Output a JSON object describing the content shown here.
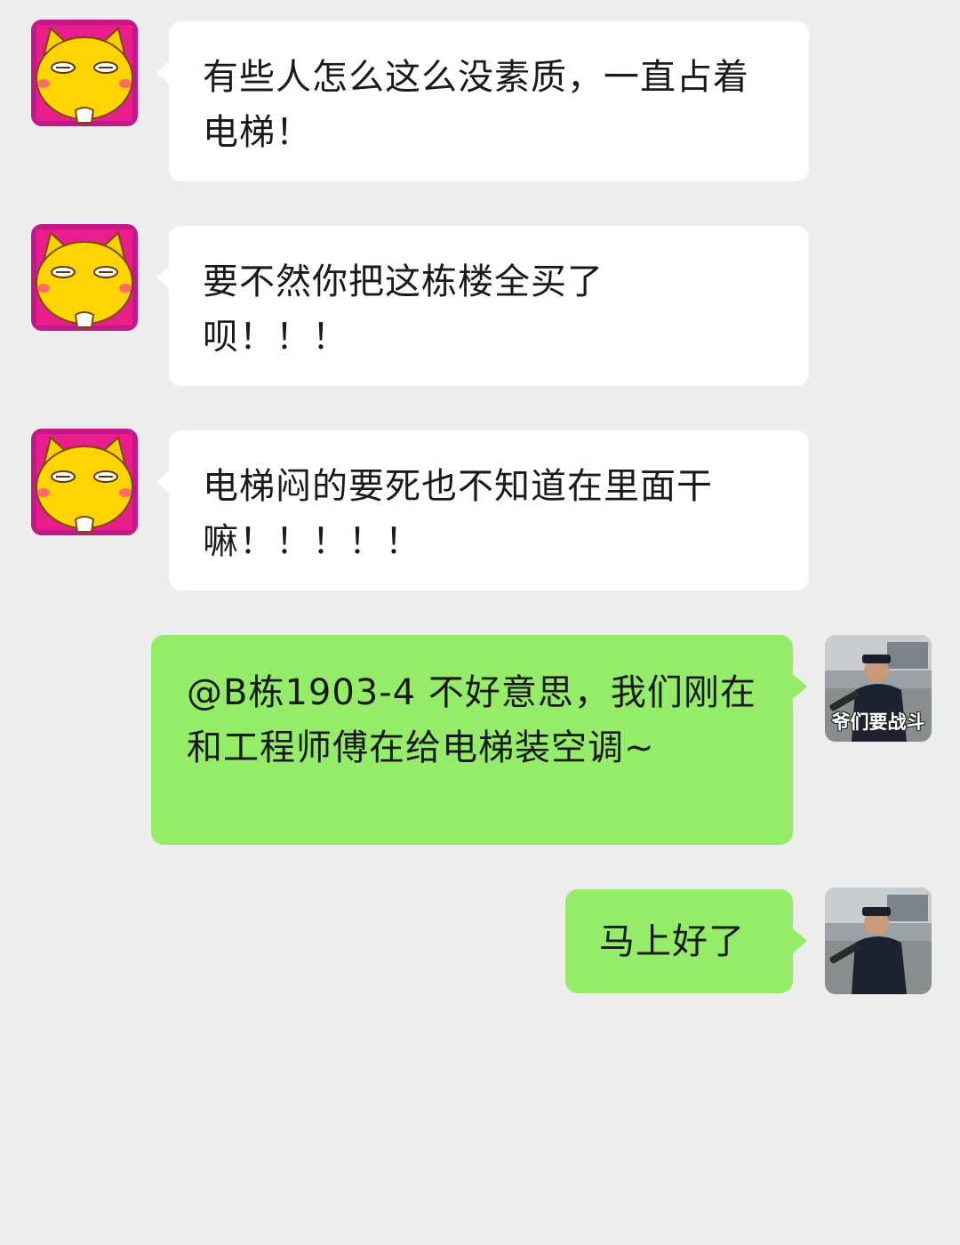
{
  "messages": [
    {
      "side": "in",
      "text": "有些人怎么这么没素质，一直占着电梯！",
      "avatar_icon": "cartoon-cat-avatar"
    },
    {
      "side": "in",
      "text": "要不然你把这栋楼全买了呗！！！",
      "avatar_icon": "cartoon-cat-avatar"
    },
    {
      "side": "in",
      "text": "电梯闷的要死也不知道在里面干嘛！！！！！",
      "avatar_icon": "cartoon-cat-avatar"
    },
    {
      "side": "out",
      "text": "@B栋1903-4 不好意思，我们刚在和工程师傅在给电梯装空调~",
      "avatar_icon": "police-photo-avatar",
      "avatar_caption": "爷们要战斗"
    },
    {
      "side": "out",
      "text": "马上好了",
      "avatar_icon": "police-photo-avatar"
    }
  ],
  "colors": {
    "background": "#ededed",
    "incoming_bubble": "#ffffff",
    "outgoing_bubble": "#95ec69"
  }
}
